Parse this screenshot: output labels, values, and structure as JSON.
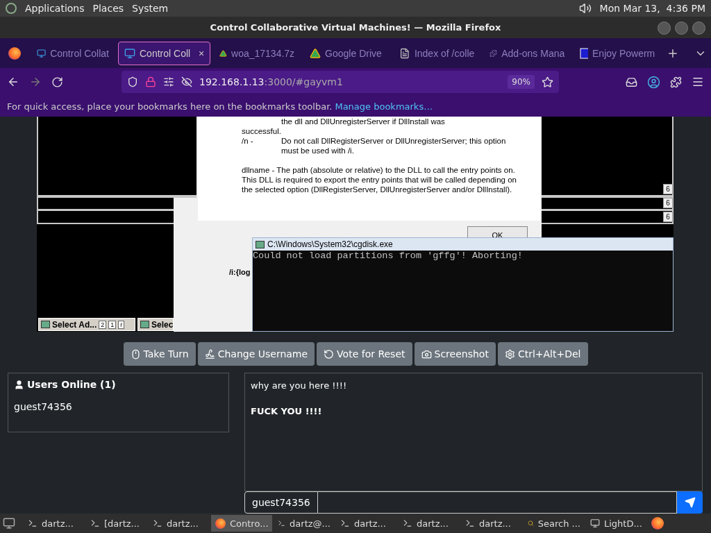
{
  "top_panel": {
    "menus": [
      "Applications",
      "Places",
      "System"
    ],
    "clock": "Mon Mar 13,  4:36 PM"
  },
  "window": {
    "title": "Control Collaborative Virtual Machines! — Mozilla Firefox"
  },
  "tabs": [
    {
      "label": "Control Collat",
      "kind": "monitor",
      "selected": false
    },
    {
      "label": "Control Coll",
      "kind": "monitor",
      "selected": true,
      "close": "×"
    },
    {
      "label": "woa_17134.7z",
      "kind": "drive",
      "selected": false
    },
    {
      "label": "Google Drive",
      "kind": "drive",
      "selected": false
    },
    {
      "label": "Index of /colle",
      "kind": "file",
      "selected": false
    },
    {
      "label": "Add-ons Mana",
      "kind": "addon",
      "selected": false
    },
    {
      "label": "Enjoy Powerm",
      "kind": "logo",
      "selected": false
    }
  ],
  "nav": {
    "host": "192.168.1.13",
    "path": ":3000/#gayvm1",
    "zoom": "90%"
  },
  "bookmarks_bar": {
    "text": "For quick access, place your bookmarks here on the bookmarks toolbar.",
    "link": "Manage bookmarks…"
  },
  "vm_screen": {
    "help": [
      {
        "kind": "continuation",
        "text": "the dll and DllUnregisterServer if DllInstall was"
      },
      {
        "kind": "plain",
        "text": "successful."
      },
      {
        "kind": "option",
        "option": "/n -",
        "text": "Do not call DllRegisterServer or DllUnregisterServer; this option must be used with /i."
      },
      {
        "kind": "paragraph",
        "text": "dllname - The path (absolute or relative) to the DLL to call the entry points on. This DLL is required to export the entry points that will be called depending on the selected option (DllRegisterServer, DllUnregisterServer and/or DllInstall)."
      }
    ],
    "ok": "OK",
    "behind_text": "/i:{log",
    "counters": [
      "6",
      "6",
      "6"
    ],
    "console": {
      "title": "C:\\Windows\\System32\\cgdisk.exe",
      "output": "Could not load partitions from 'gffg'! Aborting!"
    },
    "taskbar": [
      {
        "label": "Select Ad...",
        "mini_buttons": [
          "2",
          "1",
          "r"
        ]
      },
      {
        "label": "Selec"
      }
    ]
  },
  "vm_buttons": [
    {
      "label": "Take Turn",
      "kind": "mouse"
    },
    {
      "label": "Change Username",
      "kind": "signature"
    },
    {
      "label": "Vote for Reset",
      "kind": "reset"
    },
    {
      "label": "Screenshot",
      "kind": "camera"
    },
    {
      "label": "Ctrl+Alt+Del",
      "kind": "gear"
    }
  ],
  "users": {
    "title": "Users Online (1)",
    "list": [
      "guest74356"
    ]
  },
  "chat": {
    "messages": [
      {
        "text": "why are you here !!!!",
        "bold": false
      },
      {
        "text": "FUCK YOU !!!!",
        "bold": true
      }
    ]
  },
  "chat_input": {
    "username": "guest74356"
  },
  "taskbar": [
    {
      "label": "dartz...",
      "kind": "terminal",
      "selected": false
    },
    {
      "label": "[dartz...",
      "kind": "terminal",
      "selected": false
    },
    {
      "label": "dartz...",
      "kind": "terminal",
      "selected": false
    },
    {
      "label": "Contro...",
      "kind": "firefox",
      "selected": true
    },
    {
      "label": "dartz@...",
      "kind": "terminal",
      "selected": false
    },
    {
      "label": "dartz...",
      "kind": "terminal",
      "selected": false
    },
    {
      "label": "dartz...",
      "kind": "terminal",
      "selected": false
    },
    {
      "label": "dartz...",
      "kind": "terminal",
      "selected": false
    },
    {
      "label": "Search ...",
      "kind": "search",
      "selected": false
    },
    {
      "label": "LightD...",
      "kind": "display",
      "selected": false
    }
  ]
}
